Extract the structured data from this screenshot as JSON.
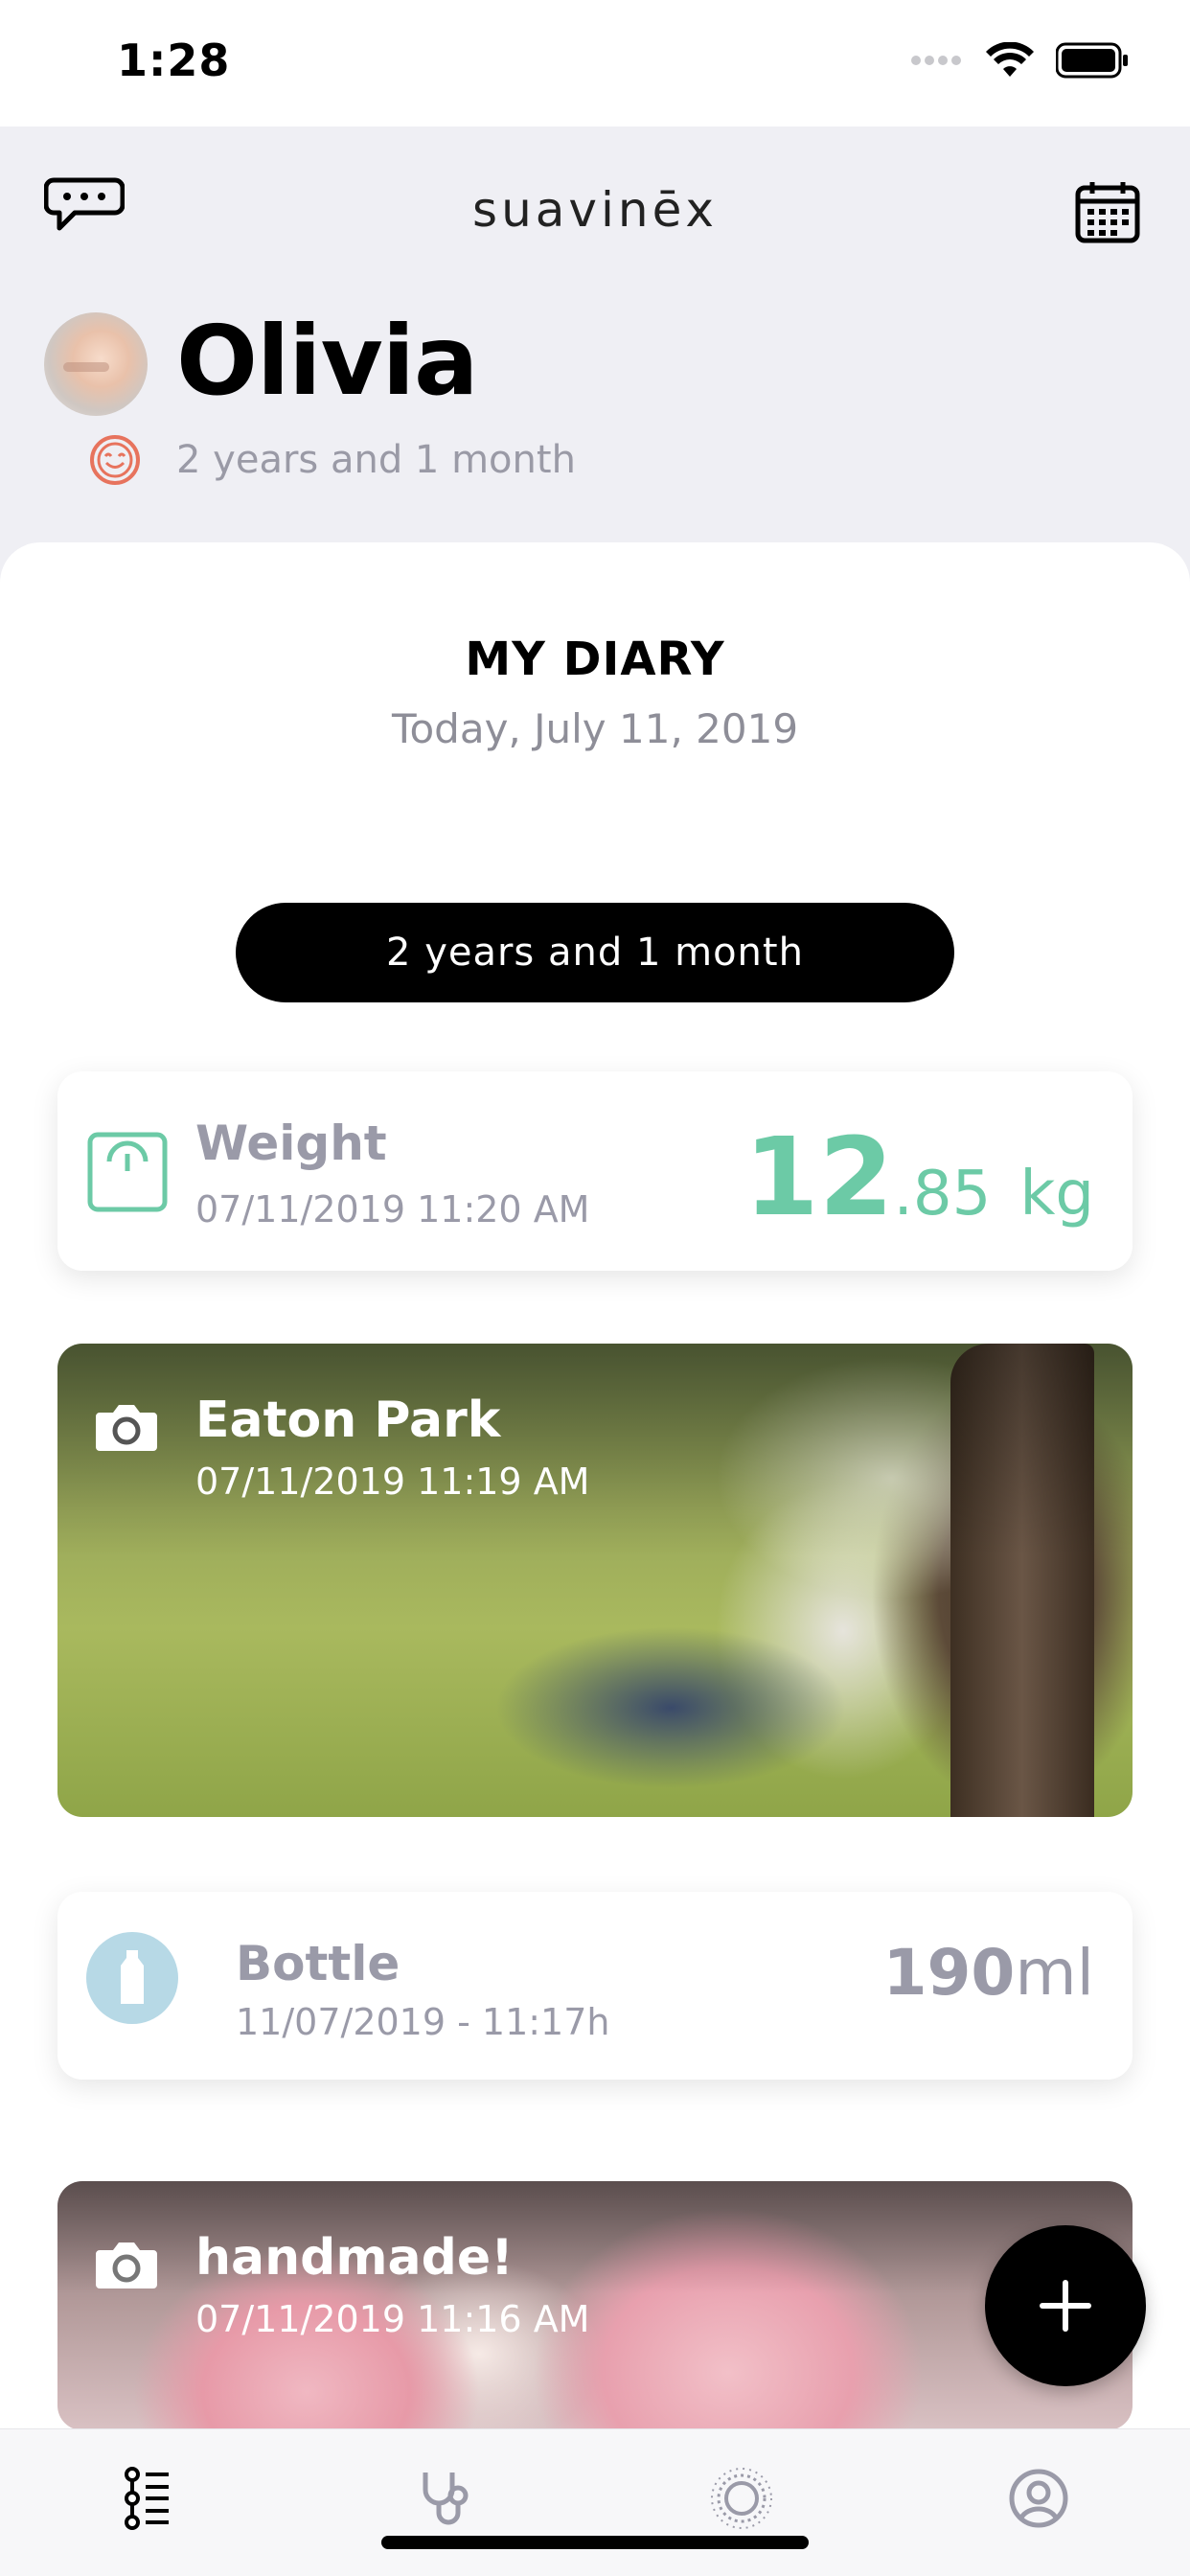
{
  "status": {
    "time": "1:28"
  },
  "header": {
    "brand": "suavinēx",
    "chat_icon": "chat-bubble-icon",
    "calendar_icon": "calendar-icon"
  },
  "profile": {
    "name": "Olivia",
    "age": "2 years and 1 month",
    "age_icon": "smiley-icon"
  },
  "diary": {
    "title": "MY DIARY",
    "date": "Today, July 11, 2019",
    "age_pill": "2 years and 1 month"
  },
  "entries": {
    "weight": {
      "title": "Weight",
      "datetime": "07/11/2019 11:20 AM",
      "value_int": "12",
      "value_dec": ".85",
      "unit": "kg",
      "color": "#6ccaa6"
    },
    "photo1": {
      "title": "Eaton Park",
      "datetime": "07/11/2019 11:19 AM"
    },
    "bottle": {
      "title": "Bottle",
      "datetime": "11/07/2019 - 11:17h",
      "value": "190",
      "unit": "ml"
    },
    "photo2": {
      "title": "handmade!",
      "datetime": "07/11/2019 11:16 AM"
    }
  },
  "fab": {
    "icon": "plus-icon"
  },
  "tabbar": {
    "tabs": [
      "timeline-icon",
      "stethoscope-icon",
      "sun-icon",
      "profile-icon"
    ]
  },
  "colors": {
    "accent": "#6ccaa6",
    "muted": "#9a9aa8",
    "background": "#efeff4"
  }
}
